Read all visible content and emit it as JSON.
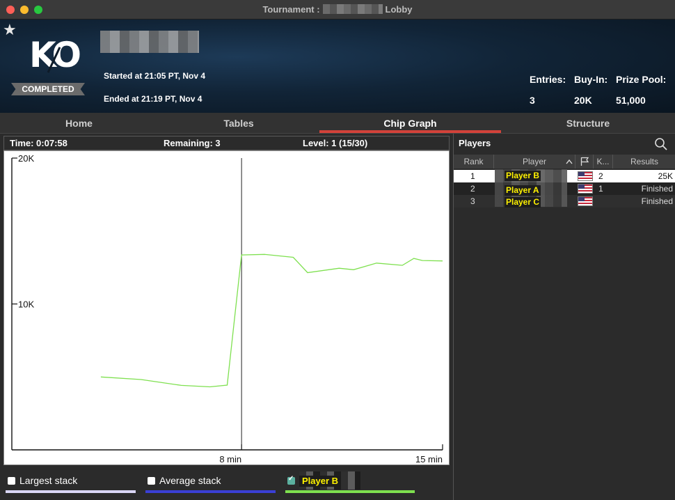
{
  "window": {
    "title_prefix": "Tournament :",
    "title_suffix": "Lobby"
  },
  "header": {
    "logo_text": "KO",
    "status_badge": "COMPLETED",
    "started": "Started at 21:05 PT, Nov 4",
    "ended": "Ended at 21:19 PT, Nov 4",
    "stats": [
      {
        "label": "Entries:",
        "value": "3"
      },
      {
        "label": "Buy-In:",
        "value": "20K"
      },
      {
        "label": "Prize Pool:",
        "value": "51,000"
      }
    ]
  },
  "tabs": [
    {
      "label": "Home"
    },
    {
      "label": "Tables"
    },
    {
      "label": "Chip Graph",
      "active": true
    },
    {
      "label": "Structure"
    }
  ],
  "graph_info": {
    "time": "Time: 0:07:58",
    "remaining": "Remaining: 3",
    "level": "Level: 1 (15/30)"
  },
  "chart_data": {
    "type": "line",
    "ytick_labels": [
      "20K",
      "10K"
    ],
    "xtick_labels": [
      "8 min",
      "15 min"
    ],
    "ylim": [
      0,
      20000
    ],
    "xlim": [
      0,
      15
    ],
    "marker_x": 8,
    "series": [
      {
        "name": "Player B",
        "color": "#7ee04f",
        "x": [
          3.1,
          4.5,
          5.9,
          6.9,
          7.5,
          8.0,
          8.8,
          9.8,
          10.3,
          11.4,
          11.9,
          12.7,
          13.6,
          14.0,
          14.3,
          15.0
        ],
        "y": [
          5000,
          4820,
          4420,
          4320,
          4440,
          13360,
          13400,
          13200,
          12150,
          12450,
          12350,
          12800,
          12650,
          13120,
          12980,
          12950
        ]
      }
    ]
  },
  "legend": [
    {
      "label": "Largest stack",
      "checked": false,
      "color": "#d9d6f5"
    },
    {
      "label": "Average stack",
      "checked": false,
      "color": "#3a3fd6"
    },
    {
      "label": "Player B",
      "checked": true,
      "color": "#7ee04f"
    }
  ],
  "players": {
    "title": "Players",
    "columns": [
      "Rank",
      "Player",
      "K...",
      "Results"
    ],
    "rows": [
      {
        "rank": "1",
        "player": "Player B",
        "k": "2",
        "result": "25K"
      },
      {
        "rank": "2",
        "player": "Player A",
        "k": "1",
        "result": "Finished"
      },
      {
        "rank": "3",
        "player": "Player C",
        "k": "",
        "result": "Finished"
      }
    ]
  },
  "colors": {
    "accent_tab": "#d2423a",
    "name_highlight": "#fff200"
  },
  "icons": [
    "star-icon",
    "search-icon",
    "sort-up-icon",
    "flag-icon",
    "us-flag-icon"
  ]
}
